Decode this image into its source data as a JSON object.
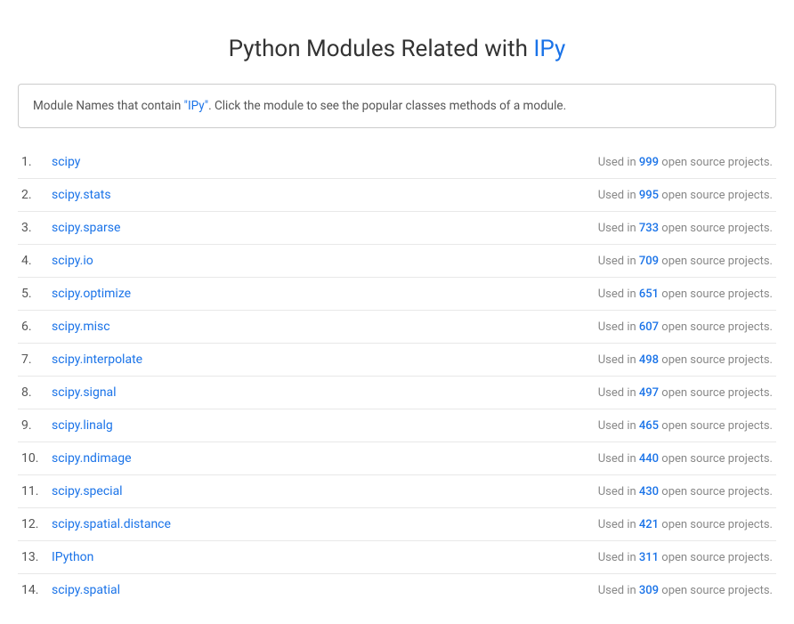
{
  "page": {
    "title_prefix": "Python Modules Related with ",
    "title_highlight": "IPy",
    "info_box": {
      "text_before": "Module Names that contain ",
      "link_text": "\"IPy\"",
      "text_after": ". Click the module to see the popular classes methods of a module."
    }
  },
  "modules": [
    {
      "number": "1.",
      "name": "scipy",
      "count": "999",
      "label": "Used in 999 open source projects."
    },
    {
      "number": "2.",
      "name": "scipy.stats",
      "count": "995",
      "label": "Used in 995 open source projects."
    },
    {
      "number": "3.",
      "name": "scipy.sparse",
      "count": "733",
      "label": "Used in 733 open source projects."
    },
    {
      "number": "4.",
      "name": "scipy.io",
      "count": "709",
      "label": "Used in 709 open source projects."
    },
    {
      "number": "5.",
      "name": "scipy.optimize",
      "count": "651",
      "label": "Used in 651 open source projects."
    },
    {
      "number": "6.",
      "name": "scipy.misc",
      "count": "607",
      "label": "Used in 607 open source projects."
    },
    {
      "number": "7.",
      "name": "scipy.interpolate",
      "count": "498",
      "label": "Used in 498 open source projects."
    },
    {
      "number": "8.",
      "name": "scipy.signal",
      "count": "497",
      "label": "Used in 497 open source projects."
    },
    {
      "number": "9.",
      "name": "scipy.linalg",
      "count": "465",
      "label": "Used in 465 open source projects."
    },
    {
      "number": "10.",
      "name": "scipy.ndimage",
      "count": "440",
      "label": "Used in 440 open source projects."
    },
    {
      "number": "11.",
      "name": "scipy.special",
      "count": "430",
      "label": "Used in 430 open source projects."
    },
    {
      "number": "12.",
      "name": "scipy.spatial.distance",
      "count": "421",
      "label": "Used in 421 open source projects."
    },
    {
      "number": "13.",
      "name": "IPython",
      "count": "311",
      "label": "Used in 311 open source projects."
    },
    {
      "number": "14.",
      "name": "scipy.spatial",
      "count": "309",
      "label": "Used in 309 open source projects."
    }
  ],
  "used_text": "Used in ",
  "projects_text": " open source projects."
}
